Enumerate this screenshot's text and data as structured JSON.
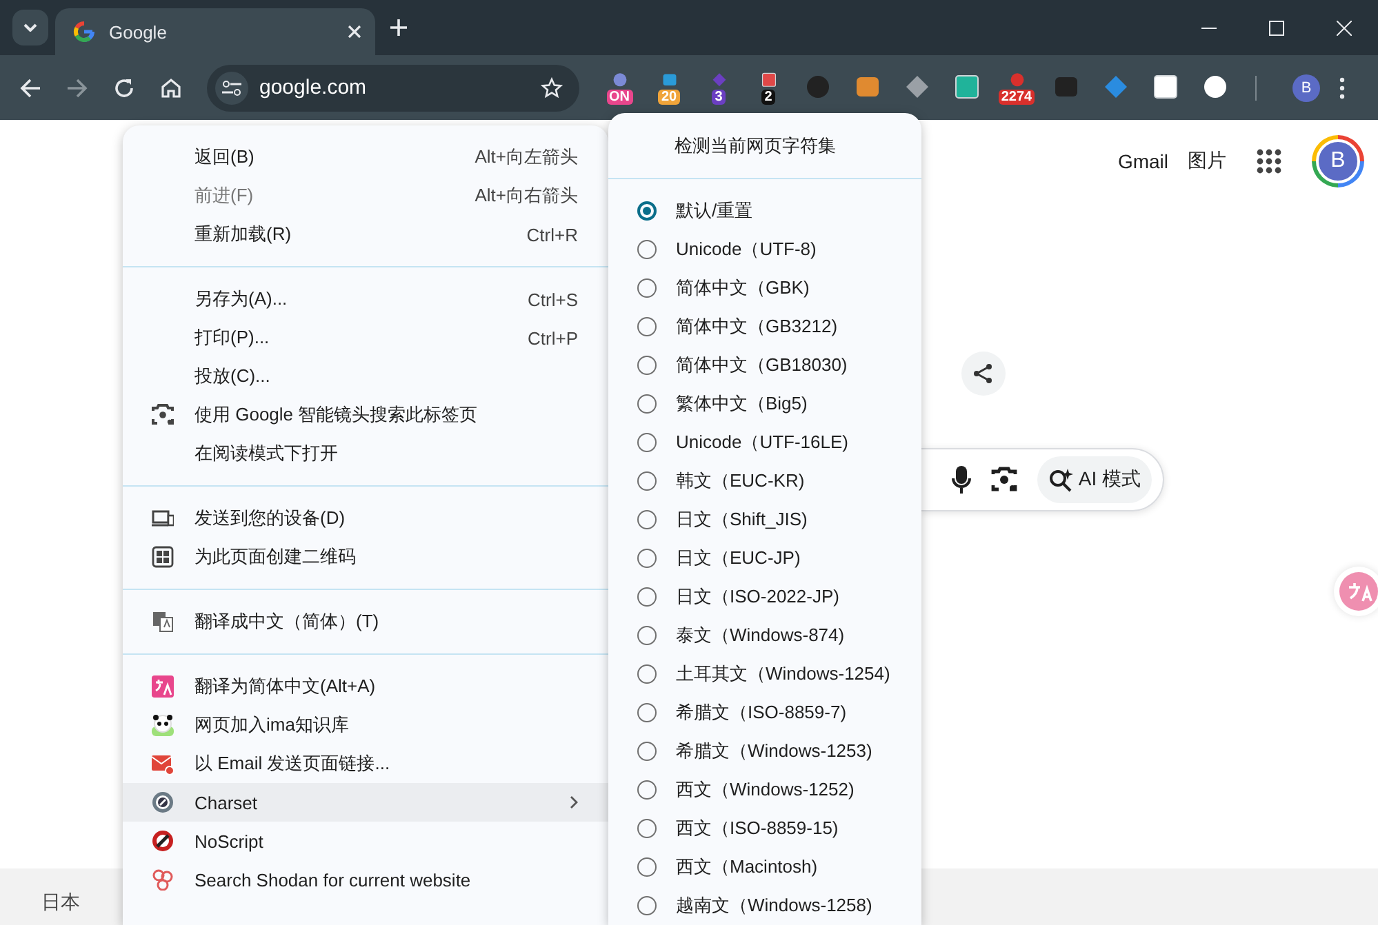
{
  "tab": {
    "title": "Google"
  },
  "address": {
    "url": "google.com"
  },
  "extensions": [
    {
      "kind": "badged",
      "badge": "ON",
      "color": "#e8468c"
    },
    {
      "kind": "badged",
      "badge": "20",
      "color": "#f0a43a"
    },
    {
      "kind": "badged",
      "badge": "3",
      "color": "#6b3fc2"
    },
    {
      "kind": "badged",
      "badge": "2",
      "color": "#111111"
    },
    {
      "kind": "plain"
    },
    {
      "kind": "plain"
    },
    {
      "kind": "plain"
    },
    {
      "kind": "plain"
    },
    {
      "kind": "badged",
      "badge": "2274",
      "color": "#d9302c"
    },
    {
      "kind": "plain"
    },
    {
      "kind": "plain"
    },
    {
      "kind": "plain"
    },
    {
      "kind": "plain"
    }
  ],
  "profile": {
    "initial": "B"
  },
  "page": {
    "links": [
      "Gmail",
      "图片"
    ],
    "avatar": "B",
    "ai_button": "AI 模式",
    "footer": "日本"
  },
  "context_menu": {
    "groups": [
      {
        "items": [
          {
            "label": "返回(B)",
            "shortcut": "Alt+向左箭头",
            "disabled": false,
            "highlighted": false,
            "submenu": false
          },
          {
            "label": "前进(F)",
            "shortcut": "Alt+向右箭头",
            "disabled": true,
            "highlighted": false,
            "submenu": false
          },
          {
            "label": "重新加载(R)",
            "shortcut": "Ctrl+R",
            "disabled": false,
            "highlighted": false,
            "submenu": false
          }
        ]
      },
      {
        "items": [
          {
            "label": "另存为(A)...",
            "shortcut": "Ctrl+S",
            "disabled": false,
            "highlighted": false,
            "submenu": false
          },
          {
            "label": "打印(P)...",
            "shortcut": "Ctrl+P",
            "disabled": false,
            "highlighted": false,
            "submenu": false
          },
          {
            "label": "投放(C)...",
            "disabled": false,
            "highlighted": false,
            "submenu": false
          },
          {
            "label": "使用 Google 智能镜头搜索此标签页",
            "disabled": false,
            "highlighted": false,
            "submenu": false
          },
          {
            "label": "在阅读模式下打开",
            "disabled": false,
            "highlighted": false,
            "submenu": false
          }
        ]
      },
      {
        "items": [
          {
            "label": "发送到您的设备(D)",
            "disabled": false,
            "highlighted": false,
            "submenu": false
          },
          {
            "label": "为此页面创建二维码",
            "disabled": false,
            "highlighted": false,
            "submenu": false
          }
        ]
      },
      {
        "items": [
          {
            "label": "翻译成中文（简体）(T)",
            "disabled": false,
            "highlighted": false,
            "submenu": false
          }
        ]
      },
      {
        "items": [
          {
            "label": "翻译为简体中文(Alt+A)",
            "disabled": false,
            "highlighted": false,
            "submenu": false
          },
          {
            "label": "网页加入ima知识库",
            "disabled": false,
            "highlighted": false,
            "submenu": false
          },
          {
            "label": "以 Email 发送页面链接...",
            "disabled": false,
            "highlighted": false,
            "submenu": false
          },
          {
            "label": "Charset",
            "disabled": false,
            "highlighted": true,
            "submenu": true
          },
          {
            "label": "NoScript",
            "disabled": false,
            "highlighted": false,
            "submenu": false
          },
          {
            "label": "Search Shodan for current website",
            "disabled": false,
            "highlighted": false,
            "submenu": false
          }
        ]
      }
    ]
  },
  "charset_menu": {
    "title": "检测当前网页字符集",
    "options": [
      {
        "label": "默认/重置",
        "selected": true
      },
      {
        "label": "Unicode（UTF-8)",
        "selected": false
      },
      {
        "label": "简体中文（GBK)",
        "selected": false
      },
      {
        "label": "简体中文（GB3212)",
        "selected": false
      },
      {
        "label": "简体中文（GB18030)",
        "selected": false
      },
      {
        "label": "繁体中文（Big5)",
        "selected": false
      },
      {
        "label": "Unicode（UTF-16LE)",
        "selected": false
      },
      {
        "label": "韩文（EUC-KR)",
        "selected": false
      },
      {
        "label": "日文（Shift_JIS)",
        "selected": false
      },
      {
        "label": "日文（EUC-JP)",
        "selected": false
      },
      {
        "label": "日文（ISO-2022-JP)",
        "selected": false
      },
      {
        "label": "泰文（Windows-874)",
        "selected": false
      },
      {
        "label": "土耳其文（Windows-1254)",
        "selected": false
      },
      {
        "label": "希腊文（ISO-8859-7)",
        "selected": false
      },
      {
        "label": "希腊文（Windows-1253)",
        "selected": false
      },
      {
        "label": "西文（Windows-1252)",
        "selected": false
      },
      {
        "label": "西文（ISO-8859-15)",
        "selected": false
      },
      {
        "label": "西文（Macintosh)",
        "selected": false
      },
      {
        "label": "越南文（Windows-1258)",
        "selected": false
      }
    ]
  }
}
